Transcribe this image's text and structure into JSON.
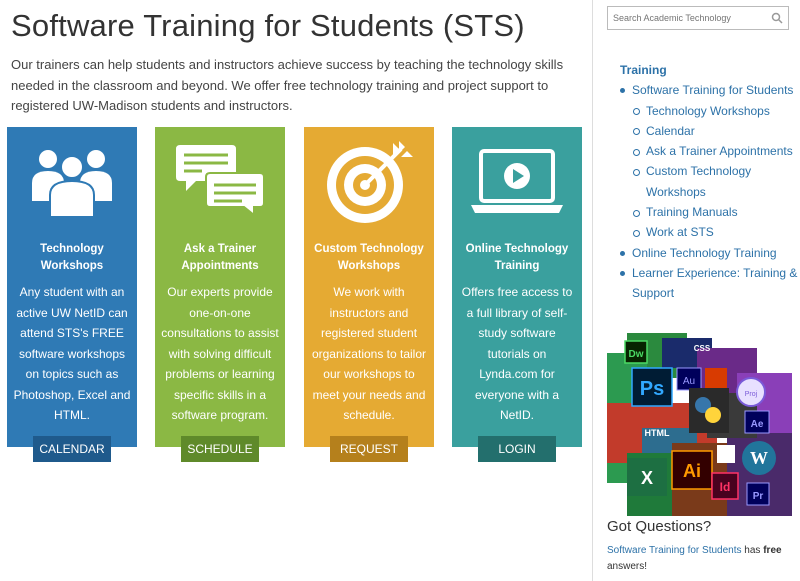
{
  "page": {
    "title": "Software Training for Students (STS)",
    "intro": "Our trainers can help students and instructors achieve success by teaching the technology skills needed in the classroom and beyond. We offer free technology training and project support to registered UW-Madison students and instructors."
  },
  "cards": [
    {
      "title": "Technology Workshops",
      "description": "Any student with an active UW NetID can attend STS's FREE software workshops on topics such as Photoshop, Excel and HTML.",
      "button": "CALENDAR",
      "icon": "people-group-icon",
      "color": "#2f7ab5"
    },
    {
      "title": "Ask a Trainer Appointments",
      "description": "Our experts provide one-on-one consultations to assist with solving difficult problems or learning specific skills in a software program.",
      "button": "SCHEDULE",
      "icon": "chat-bubbles-icon",
      "color": "#8bb844"
    },
    {
      "title": "Custom Technology Workshops",
      "description": "We work with instructors and registered student organizations to tailor our workshops to meet your needs and schedule.",
      "button": "REQUEST",
      "icon": "target-icon",
      "color": "#e5aa33"
    },
    {
      "title": "Online Technology Training",
      "description": "Offers free access to a full library of self-study software tutorials on Lynda.com for everyone with a NetID.",
      "button": "LOGIN",
      "icon": "laptop-play-icon",
      "color": "#3aa09e"
    }
  ],
  "sidebar": {
    "search_placeholder": "Search Academic Technology",
    "nav_heading": "Training",
    "nav": [
      {
        "label": "Software Training for Students",
        "level": 1
      },
      {
        "label": "Technology Workshops",
        "level": 2
      },
      {
        "label": "Calendar",
        "level": 2
      },
      {
        "label": "Ask a Trainer Appointments",
        "level": 2
      },
      {
        "label": "Custom Technology Workshops",
        "level": 2
      },
      {
        "label": "Training Manuals",
        "level": 2
      },
      {
        "label": "Work at STS",
        "level": 2
      },
      {
        "label": "Online Technology Training",
        "level": 1
      },
      {
        "label": "Learner Experience: Training & Support",
        "level": 1
      }
    ],
    "collage_labels": [
      "Dw",
      "CSS",
      "Ps",
      "Au",
      "HTML",
      "Ae",
      "Ai",
      "Id",
      "Pr",
      "Proj"
    ],
    "got_questions": "Got Questions?",
    "note_link": "Software Training for Students",
    "note_mid": " has ",
    "note_bold": "free",
    "note_end": " answers!"
  },
  "colors": {
    "accent_link": "#2d72a8",
    "card_blue": "#2f7ab5",
    "card_green": "#8bb844",
    "card_gold": "#e5aa33",
    "card_teal": "#3aa09e"
  }
}
